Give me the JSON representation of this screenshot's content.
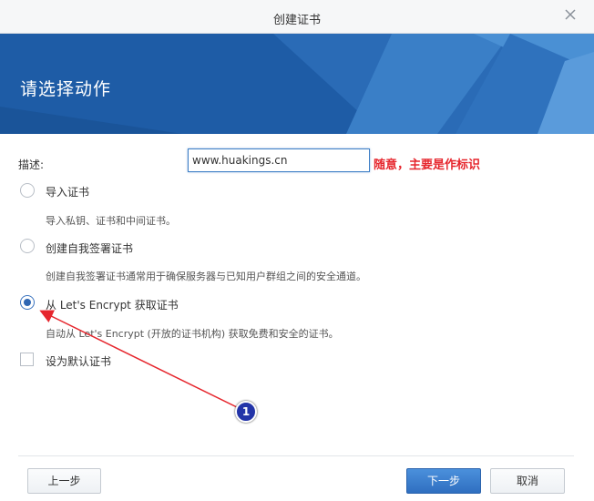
{
  "window": {
    "title": "创建证书"
  },
  "banner": {
    "heading": "请选择动作"
  },
  "form": {
    "description_label": "描述:",
    "description_value": "www.huakings.cn",
    "annotation_note": "随意，主要是作标识"
  },
  "options": [
    {
      "label": "导入证书",
      "sub": "导入私钥、证书和中间证书。",
      "checked": false
    },
    {
      "label": "创建自我签署证书",
      "sub": "创建自我签署证书通常用于确保服务器与已知用户群组之间的安全通道。",
      "checked": false
    },
    {
      "label": "从 Let's Encrypt 获取证书",
      "sub": "自动从 Let's Encrypt (开放的证书机构) 获取免费和安全的证书。",
      "checked": true
    }
  ],
  "default_cert": {
    "label": "设为默认证书",
    "checked": false
  },
  "footer": {
    "prev": "上一步",
    "next": "下一步",
    "cancel": "取消"
  },
  "annotation": {
    "badge": "1"
  },
  "colors": {
    "accent": "#2e66b3",
    "annotation": "#e6262d",
    "banner": "#1f5fa8"
  }
}
